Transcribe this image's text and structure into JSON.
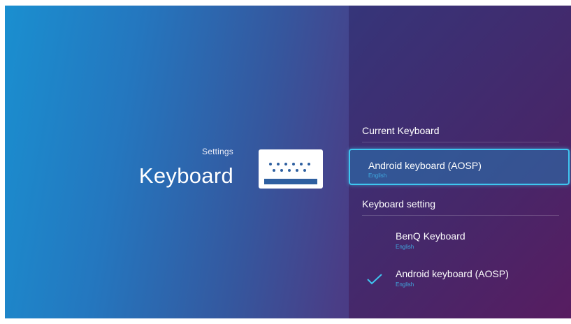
{
  "header": {
    "breadcrumb": "Settings",
    "title": "Keyboard",
    "icon": "keyboard-icon"
  },
  "current_keyboard": {
    "section_label": "Current Keyboard",
    "name": "Android keyboard (AOSP)",
    "language": "English"
  },
  "keyboard_setting": {
    "section_label": "Keyboard setting",
    "items": [
      {
        "name": "BenQ Keyboard",
        "language": "English",
        "checked": false
      },
      {
        "name": "Android keyboard (AOSP)",
        "language": "English",
        "checked": true
      }
    ]
  },
  "colors": {
    "accent": "#3ec6f0",
    "subtext": "#3fa9e0"
  }
}
